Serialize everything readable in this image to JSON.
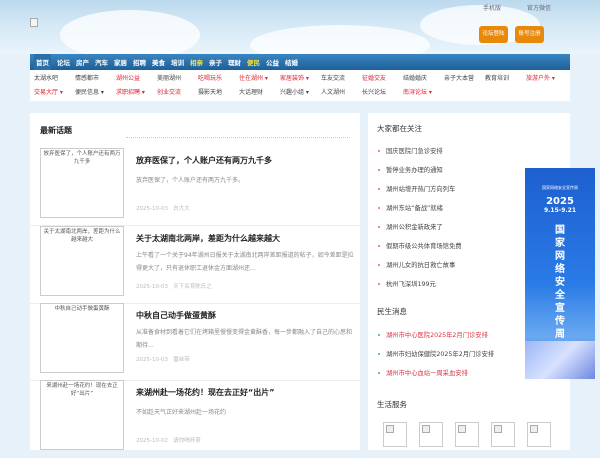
{
  "header": {
    "mobile": "手机版",
    "wechat": "官方微信",
    "login_button": "论坛登陆",
    "register_button": "账号注册"
  },
  "nav": [
    "首页",
    "论坛",
    "房产",
    "汽车",
    "家居",
    "招聘",
    "美食",
    "培训",
    "相亲",
    "亲子",
    "理财",
    "便民",
    "公益",
    "结婚"
  ],
  "subnav": [
    {
      "label": "太湖水吧",
      "red": false
    },
    {
      "label": "情感都市",
      "red": false
    },
    {
      "label": "湖州公益",
      "red": true
    },
    {
      "label": "美丽湖州",
      "red": false
    },
    {
      "label": "吃喝玩乐",
      "red": true
    },
    {
      "label": "住在湖州 ▾",
      "red": true
    },
    {
      "label": "家居装饰 ▾",
      "red": true
    },
    {
      "label": "车友交流",
      "red": false
    },
    {
      "label": "征婚交友",
      "red": true
    },
    {
      "label": "结婚婚庆",
      "red": false
    },
    {
      "label": "亲子大本营",
      "red": false
    },
    {
      "label": "教育培训",
      "red": false
    },
    {
      "label": "旅游户外 ▾",
      "red": true
    },
    {
      "label": "交易大厅 ▾",
      "red": true
    },
    {
      "label": "便民信息 ▾",
      "red": false
    },
    {
      "label": "求职招聘 ▾",
      "red": true
    },
    {
      "label": "创业交流",
      "red": true
    },
    {
      "label": "摄影天地",
      "red": false
    },
    {
      "label": "大话理财",
      "red": false
    },
    {
      "label": "兴趣小组 ▾",
      "red": false
    },
    {
      "label": "人文湖州",
      "red": false
    },
    {
      "label": "长兴论坛",
      "red": false
    },
    {
      "label": "南浔论坛 ▾",
      "red": true
    }
  ],
  "latest": {
    "title": "最新话题",
    "articles": [
      {
        "thumb_alt": "放弃医保了，个人账户还有两万九千多",
        "title": "放弃医保了，个人账户还有两万九千多",
        "desc": "放弃医保了，个人账户还有两万九千多。",
        "date": "2025-10-03",
        "author": "白大大"
      },
      {
        "thumb_alt": "关于太湖南北两岸，差距为什么越来越大",
        "title": "关于太湖南北两岸，差距为什么越来越大",
        "desc": "上午看了一个关于94年湖州日报关于太湖南北两岸差距报道的帖子，如今差距是拉得更大了，只有退休职工退休金方面湖州还...",
        "date": "2025-10-03",
        "author": "天下名育陈氏之"
      },
      {
        "thumb_alt": "中秋自己动手做蛋黄酥",
        "title": "中秋自己动手做蛋黄酥",
        "desc": "从准备食材到看着它们在烤箱里慢慢变得金黄酥香，每一步都融入了自己的心思和期待...",
        "date": "2025-10-03",
        "author": "雷丝带"
      },
      {
        "thumb_alt": "来湖州赴一场花约！现在去正好“出片”",
        "title": "来湖州赴一场花约！现在去正好“出片”",
        "desc": "不如趁天气正好来湖州赴一场花约",
        "date": "2025-10-02",
        "author": "请你喝杯茶"
      }
    ]
  },
  "focus": {
    "title": "大家都在关注",
    "items": [
      "国庆医院门急诊安排",
      "暂停业务办理的通知",
      "湖州站增开热门方向列车",
      "湖州东站“备战”就绪",
      "湖州公积金新政来了",
      "假期市级公共体育场馆免费",
      "湖州儿女的抗日救亡故事",
      "杭州飞深圳199元"
    ]
  },
  "livelihood": {
    "title": "民生消息",
    "items": [
      {
        "label": "湖州市中心医院2025年2月门诊安排",
        "red": true
      },
      {
        "label": "湖州市妇幼保健院2025年2月门诊安排",
        "red": false
      },
      {
        "label": "湖州市中心血站一周采血安排",
        "red": true
      }
    ]
  },
  "services": {
    "title": "生活服务",
    "count": 5
  },
  "ad": {
    "small": "国家网络安全宣传周",
    "year": "2025",
    "dates": "9.15-9.21",
    "vertical": "国家网络安全宣传周"
  },
  "colors": {
    "nav": "#2a73b2",
    "button": "#e8890c",
    "red_link": "#d23"
  }
}
